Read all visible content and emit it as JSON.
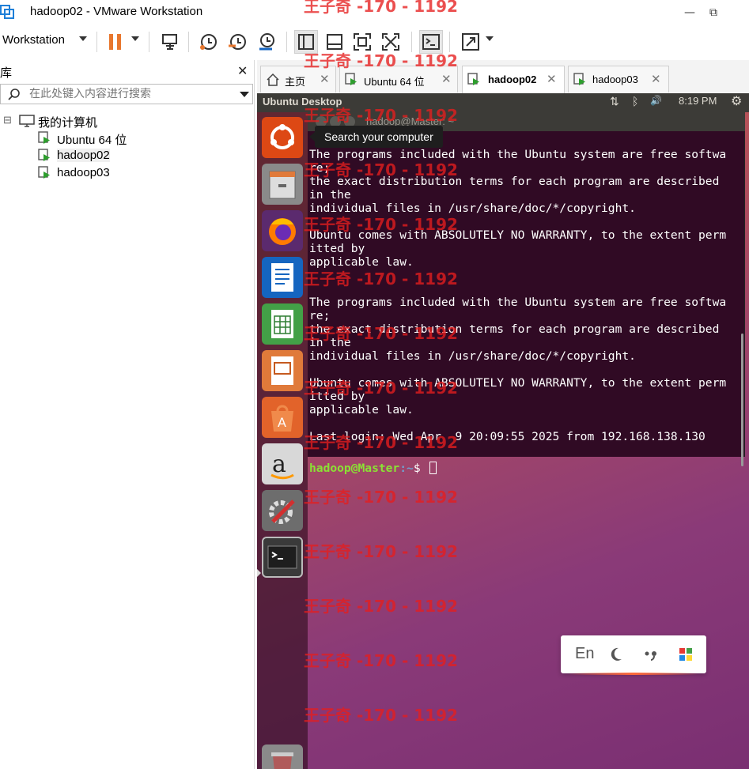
{
  "window": {
    "title": "hadoop02 - VMware Workstation",
    "minimize_glyph": "—",
    "restore_glyph": "⧉",
    "colors": {
      "accent_orange": "#e8772e",
      "icon_blue": "#1565c0"
    }
  },
  "toolbar": {
    "menu_label": "Workstation",
    "icons": [
      "pause-icon",
      "send-ctrl-alt-del-icon",
      "snapshot-icon",
      "revert-snapshot-icon",
      "snapshot-manager-icon",
      "show-library-icon",
      "thumbnail-bar-icon",
      "full-screen-icon",
      "unity-icon",
      "console-view-icon",
      "stretch-guest-icon"
    ]
  },
  "library": {
    "title": "库",
    "close_glyph": "✕",
    "search_placeholder": "在此处键入内容进行搜索",
    "tree": {
      "root_label": "我的计算机",
      "expander": "⊟",
      "items": [
        {
          "label": "Ubuntu 64 位"
        },
        {
          "label": "hadoop02"
        },
        {
          "label": "hadoop03"
        }
      ]
    }
  },
  "tabs": [
    {
      "label": "主页",
      "close": "✕"
    },
    {
      "label": "Ubuntu 64 位",
      "close": "✕"
    },
    {
      "label": "hadoop02",
      "close": "✕",
      "active": true
    },
    {
      "label": "hadoop03",
      "close": "✕"
    }
  ],
  "guest": {
    "panel_title": "Ubuntu Desktop",
    "clock": "8:19 PM",
    "indicator_icons": [
      "network-icon",
      "bluetooth-icon",
      "volume-icon",
      "settings-gear-icon"
    ],
    "indicator_glyphs": {
      "network": "⇅",
      "bluetooth": "ᛒ",
      "volume": "🔊",
      "gear": "⚙"
    },
    "tooltip": "Search your computer",
    "launcher": [
      "dash-home-icon",
      "files-icon",
      "firefox-icon",
      "writer-icon",
      "calc-icon",
      "impress-icon",
      "software-center-icon",
      "amazon-icon",
      "system-settings-icon",
      "terminal-icon",
      "trash-icon"
    ],
    "terminal": {
      "title": "hadoop@Master: ~",
      "output": "The programs included with the Ubuntu system are free softwa\nre;\nthe exact distribution terms for each program are described\nin the\nindividual files in /usr/share/doc/*/copyright.\n\nUbuntu comes with ABSOLUTELY NO WARRANTY, to the extent perm\nitted by\napplicable law.\n\n\nThe programs included with the Ubuntu system are free softwa\nre;\nthe exact distribution terms for each program are described\nin the\nindividual files in /usr/share/doc/*/copyright.\n\nUbuntu comes with ABSOLUTELY NO WARRANTY, to the extent perm\nitted by\napplicable law.\n\nLast login: Wed Apr  9 20:09:55 2025 from 192.168.138.130",
      "prompt_user": "hadoop@Master",
      "prompt_path": ":~",
      "prompt_symbol": "$ "
    },
    "ime": {
      "lang": "En",
      "icons": [
        "moon-icon",
        "punctuation-icon",
        "grid-icon"
      ]
    }
  },
  "watermark": "王子奇 -170 - 1192"
}
